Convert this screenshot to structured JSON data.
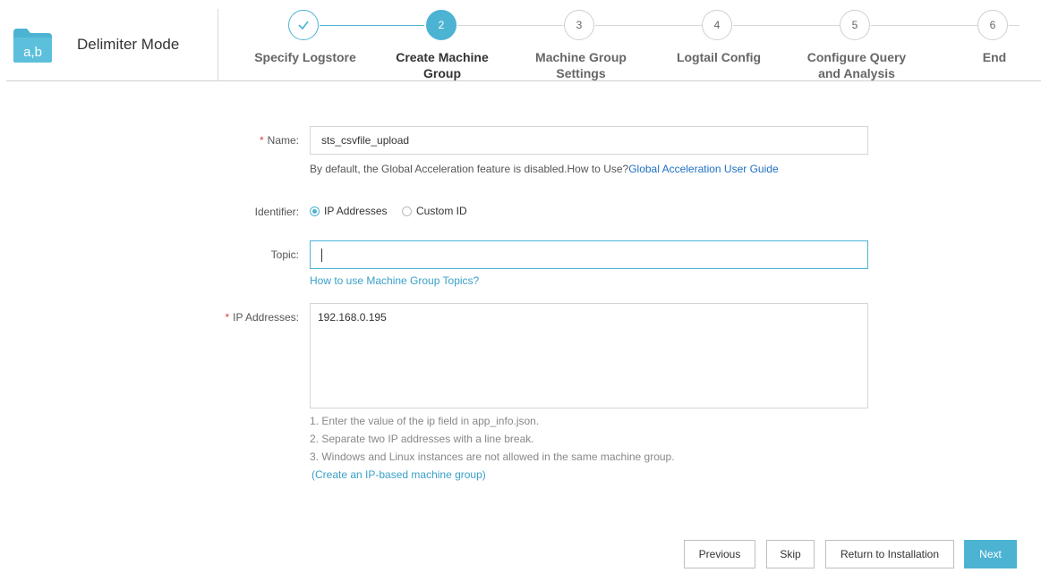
{
  "header": {
    "mode_title": "Delimiter Mode",
    "icon_text": "a,b",
    "icon_color": "#4db3d3",
    "steps": [
      {
        "number": "",
        "label_line1": "Specify Logstore",
        "label_line2": "",
        "state": "done"
      },
      {
        "number": "2",
        "label_line1": "Create Machine",
        "label_line2": "Group",
        "state": "active"
      },
      {
        "number": "3",
        "label_line1": "Machine Group",
        "label_line2": "Settings",
        "state": "todo"
      },
      {
        "number": "4",
        "label_line1": "Logtail Config",
        "label_line2": "",
        "state": "todo"
      },
      {
        "number": "5",
        "label_line1": "Configure Query",
        "label_line2": "and Analysis",
        "state": "todo"
      },
      {
        "number": "6",
        "label_line1": "End",
        "label_line2": "",
        "state": "todo"
      }
    ]
  },
  "form": {
    "required_mark": "*",
    "name_label": "Name:",
    "name_value": "sts_csvfile_upload",
    "name_help": "By default, the Global Acceleration feature is disabled.How to Use?",
    "name_help_link": "Global Acceleration User Guide",
    "identifier_label": "Identifier:",
    "identifier_options": [
      "IP Addresses",
      "Custom ID"
    ],
    "identifier_selected": "IP Addresses",
    "topic_label": "Topic:",
    "topic_value": "",
    "topic_help_link": "How to use Machine Group Topics?",
    "ip_label": "IP Addresses:",
    "ip_value": "192.168.0.195",
    "ip_notes": [
      "1. Enter the value of the ip field in app_info.json.",
      "2. Separate two IP addresses with a line break.",
      "3. Windows and Linux instances are not allowed in the same machine group."
    ],
    "ip_create_link": "(Create an IP-based machine group)"
  },
  "footer": {
    "previous_label": "Previous",
    "skip_label": "Skip",
    "return_label": "Return to Installation",
    "next_label": "Next"
  },
  "colors": {
    "accent": "#4db3d3",
    "link": "#1e6fc2",
    "required": "#e04040"
  }
}
